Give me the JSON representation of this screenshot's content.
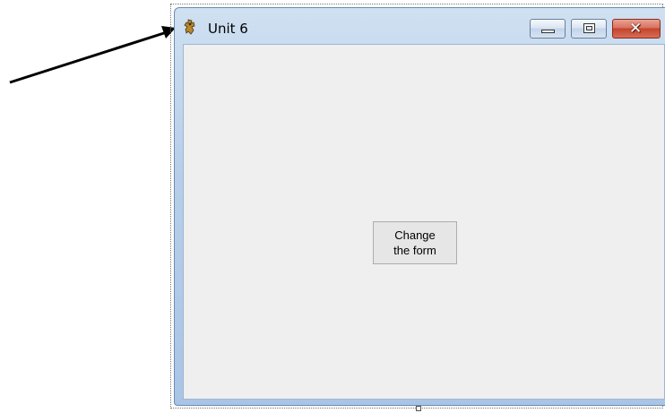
{
  "window": {
    "title": "Unit 6",
    "icon": "app-icon",
    "caption_buttons": [
      "minimize-icon",
      "maximize-icon",
      "close-icon"
    ],
    "close_glyph": "✕"
  },
  "form": {
    "button_label": "Change\nthe form"
  },
  "annotation": {
    "arrow": "arrow pointing to window icon"
  }
}
